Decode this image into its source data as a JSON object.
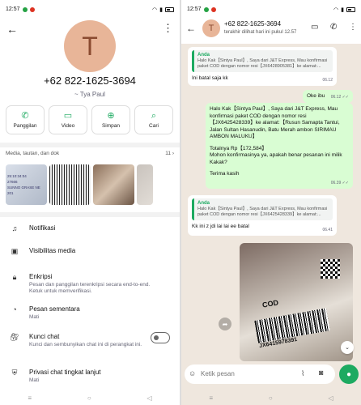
{
  "left": {
    "status_time": "12:57",
    "avatar_letter": "T",
    "phone": "+62 822-1625-3694",
    "name": "~ Tya Paul",
    "actions": [
      {
        "label": "Panggilan",
        "icon": "phone-icon",
        "glyph": "✆"
      },
      {
        "label": "Video",
        "icon": "video-icon",
        "glyph": "▭"
      },
      {
        "label": "Simpan",
        "icon": "add-person-icon",
        "glyph": "⊕"
      },
      {
        "label": "Cari",
        "icon": "search-icon",
        "glyph": "⌕"
      }
    ],
    "media_label": "Media, tautan, dan dok",
    "media_count": "11",
    "thumb1_text": [
      "25:10:34:04",
      "27666",
      "SUNNO GRASE NE",
      "201"
    ],
    "menu": {
      "notifikasi": "Notifikasi",
      "visibilitas": "Visibilitas media",
      "enkripsi_title": "Enkripsi",
      "enkripsi_sub": "Pesan dan panggilan terenkripsi secara end-to-end. Ketuk untuk memverifikasi.",
      "pesan_title": "Pesan sementara",
      "pesan_sub": "Mati",
      "kunci_title": "Kunci chat",
      "kunci_sub": "Kunci dan sembunyikan chat ini di perangkat ini.",
      "privasi_title": "Privasi chat tingkat lanjut",
      "privasi_sub": "Mati"
    }
  },
  "right": {
    "status_time": "12:57",
    "avatar_letter": "T",
    "contact": "+62 822-1625-3694",
    "last_seen": "terakhir dilihat hari ini pukul 12.57",
    "messages": {
      "m1_quote_name": "Anda",
      "m1_quote": "Halo Kak【Sintya Paul】, Saya dari J&T Express, Mau konfirmasi paket COD dengan nomor resi【JX6428905381】ke alamat:...",
      "m1_text": "Ini batal saja kk",
      "m1_time": "06.12",
      "m2_text": "Oke ibu",
      "m2_time": "06.12 ✓✓",
      "m3_text": "Halo Kak【Sintya Paul】, Saya dari J&T Express, Mau konfirmasi paket COD dengan nomor resi【JX6425428339】ke alamat:【Rusun Samapta Tantui, Jalan Sultan Hasanudin, Batu Merah  ambon SIRIMAU AMBON MALUKU】",
      "m3_total": "Totalnya Rp【172,584】",
      "m3_ask": "Mohon konfirmasinya ya, apakah benar pesanan ini milik Kakak?",
      "m3_thanks": "Terima kasih",
      "m3_time": "06.39 ✓✓",
      "m4_quote_name": "Anda",
      "m4_quote": "Halo Kak【Sintya Paul】, Saya dari J&T Express, Mau konfirmasi paket COD dengan nomor resi【JX6425428339】ke alamat:...",
      "m4_text": "Kk ini z jdi lai lai ee batal",
      "m4_time": "06.41"
    },
    "photo_text1": "COD",
    "photo_text2": "JX6415978391",
    "composer_placeholder": "Ketik pesan"
  }
}
